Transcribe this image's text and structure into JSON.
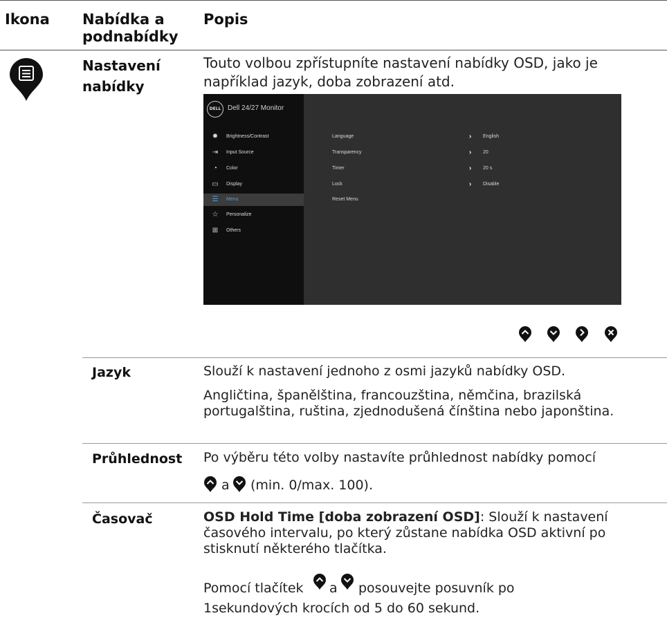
{
  "headers": {
    "icon": "Ikona",
    "menu": "Nabídka a podnabídky",
    "desc": "Popis"
  },
  "menu_section": {
    "name": "Nastavení nabídky",
    "description": "Touto volbou zpřístupníte nastavení nabídky OSD, jako je například jazyk, doba zobrazení atd.",
    "icon": "menu-list-icon"
  },
  "osd": {
    "logo": "DELL",
    "title": "Dell 24/27 Monitor",
    "menu_items": [
      {
        "label": "Brightness/Contrast",
        "icon": "brightness-icon",
        "selected": false
      },
      {
        "label": "Input Source",
        "icon": "input-source-icon",
        "selected": false
      },
      {
        "label": "Color",
        "icon": "color-icon",
        "selected": false
      },
      {
        "label": "Display",
        "icon": "display-icon",
        "selected": false
      },
      {
        "label": "Menu",
        "icon": "menu-icon",
        "selected": true
      },
      {
        "label": "Personalize",
        "icon": "star-icon",
        "selected": false
      },
      {
        "label": "Others",
        "icon": "others-icon",
        "selected": false
      }
    ],
    "settings": [
      {
        "name": "Language",
        "value": "English"
      },
      {
        "name": "Transparency",
        "value": "20"
      },
      {
        "name": "Timer",
        "value": "20 s"
      },
      {
        "name": "Lock",
        "value": "Disable"
      },
      {
        "name": "Reset Menu",
        "value": ""
      }
    ],
    "colors": {
      "selected_text": "#5b9bd5",
      "panel_left": "#0f0f0f",
      "panel_right": "#2f2f2f"
    }
  },
  "nav_buttons": [
    "up-arrow-button-icon",
    "down-arrow-button-icon",
    "right-arrow-button-icon",
    "close-button-icon"
  ],
  "rows": {
    "language": {
      "label": "Jazyk",
      "text1": "Slouží k nastavení jednoho z osmi jazyků nabídky OSD.",
      "text2": "Angličtina, španělština, francouzština, němčina, brazilská portugalština, ruština, zjednodušená čínština nebo japonština."
    },
    "transparency": {
      "label": "Průhlednost",
      "text1": "Po výběru této volby nastavíte průhlednost nabídky pomocí",
      "joiner": "a",
      "text2": "(min. 0/max. 100)."
    },
    "timer": {
      "label": "Časovač",
      "bold_lead": "OSD Hold Time [doba zobrazení OSD]",
      "text1": ": Slouží k nastavení časového intervalu, po který zůstane nabídka OSD aktivní po stisknutí některého tlačítka.",
      "text2_a": "Pomocí tlačítek",
      "joiner": "a",
      "text2_b": "posouvejte posuvník po",
      "text3": "1sekundových krocích od 5 do 60 sekund."
    }
  }
}
